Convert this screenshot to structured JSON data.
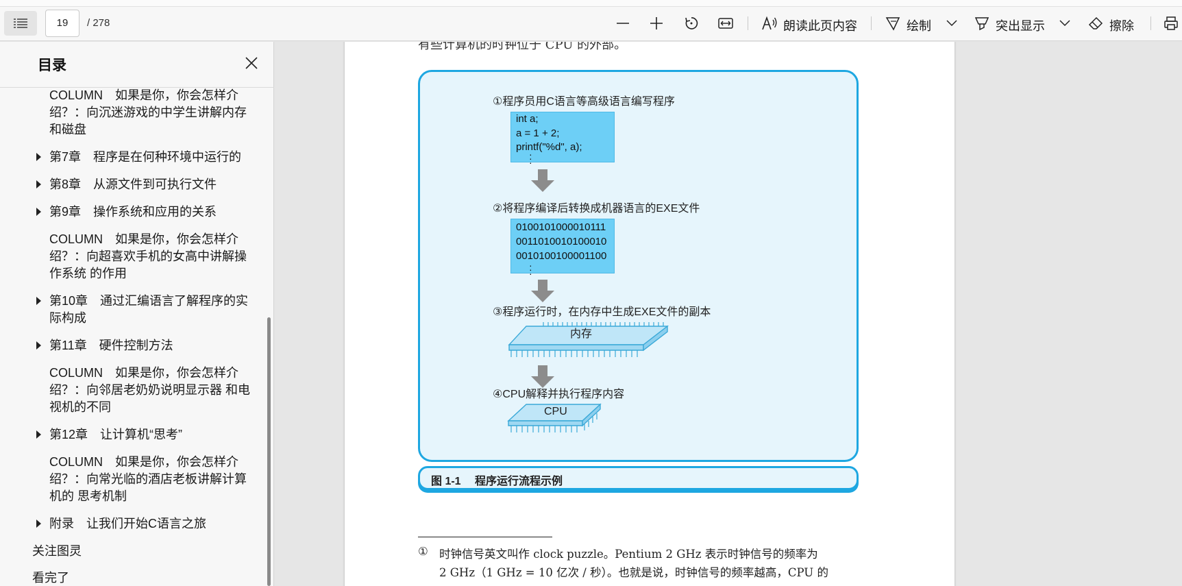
{
  "toolbar": {
    "page_current": "19",
    "page_total": "/ 278",
    "read_aloud_label": "朗读此页内容",
    "draw_label": "绘制",
    "highlight_label": "突出显示",
    "erase_label": "擦除"
  },
  "sidebar": {
    "title": "目录",
    "items": [
      {
        "label_lines": [
          "COLUMN　如果是你，你会怎样介",
          "绍？：向沉迷游戏的中学生讲解内存",
          "和磁盘"
        ],
        "has_arrow": false
      },
      {
        "label_lines": [
          "第7章　程序是在何种环境中运行的"
        ],
        "has_arrow": true
      },
      {
        "label_lines": [
          "第8章　从源文件到可执行文件"
        ],
        "has_arrow": true
      },
      {
        "label_lines": [
          "第9章　操作系统和应用的关系"
        ],
        "has_arrow": true
      },
      {
        "label_lines": [
          "COLUMN　如果是你，你会怎样介",
          "绍？：向超喜欢手机的女高中讲解操",
          "作系统 的作用"
        ],
        "has_arrow": false
      },
      {
        "label_lines": [
          "第10章　通过汇编语言了解程序的实",
          "际构成"
        ],
        "has_arrow": true
      },
      {
        "label_lines": [
          "第11章　硬件控制方法"
        ],
        "has_arrow": true
      },
      {
        "label_lines": [
          "COLUMN　如果是你，你会怎样介",
          "绍？：向邻居老奶奶说明显示器 和电",
          "视机的不同"
        ],
        "has_arrow": false
      },
      {
        "label_lines": [
          "第12章　让计算机“思考”"
        ],
        "has_arrow": true
      },
      {
        "label_lines": [
          "COLUMN　如果是你，你会怎样介",
          "绍？：向常光临的酒店老板讲解计算",
          "机的 思考机制"
        ],
        "has_arrow": false
      },
      {
        "label_lines": [
          "附录　让我们开始C语言之旅"
        ],
        "has_arrow": true
      },
      {
        "label_lines": [
          "关注图灵"
        ],
        "has_arrow": false
      },
      {
        "label_lines": [
          "看完了"
        ],
        "has_arrow": false
      }
    ]
  },
  "document": {
    "top_text": "有些计算机的时钟位于 CPU 的外部。",
    "figure": {
      "step1": "①程序员用C语言等高级语言编写程序",
      "code": [
        "int a;",
        "a = 1 + 2;",
        "printf(\"%d\", a);"
      ],
      "step2": "②将程序编译后转换成机器语言的EXE文件",
      "binary": [
        "0100101000010111",
        "0011010010100010",
        "0010100100001100"
      ],
      "step3": "③程序运行时，在内存中生成EXE文件的副本",
      "memory_label": "内存",
      "step4": "④CPU解释并执行程序内容",
      "cpu_label": "CPU",
      "caption_num": "图 1-1",
      "caption_text": "程序运行流程示例"
    },
    "footnote": {
      "marker": "①",
      "line1": "时钟信号英文叫作 clock puzzle。Pentium 2 GHz 表示时钟信号的频率为",
      "line2": "2 GHz（1 GHz = 10 亿次 / 秒）。也就是说，时钟信号的频率越高，CPU 的"
    }
  },
  "colors": {
    "accent": "#1ea7e1",
    "figure_bg": "#e6f5fc",
    "codebox": "#6dcff6"
  }
}
